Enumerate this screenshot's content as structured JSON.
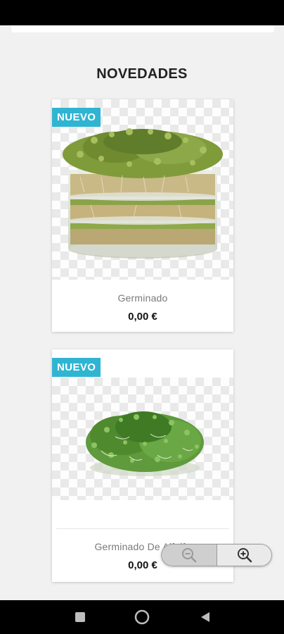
{
  "section": {
    "title": "NOVEDADES"
  },
  "products": [
    {
      "badge": "NUEVO",
      "name": "Germinado",
      "price": "0,00 €",
      "image_icon": "sprouting-jar-image"
    },
    {
      "badge": "NUEVO",
      "name": "Germinado De Alfalfa",
      "price": "0,00 €",
      "image_icon": "alfalfa-sprouts-image"
    }
  ],
  "zoom": {
    "out_icon": "zoom-out-icon",
    "in_icon": "zoom-in-icon"
  },
  "navigation": {
    "recents_icon": "square-recents-icon",
    "home_icon": "circle-home-icon",
    "back_icon": "triangle-back-icon"
  },
  "colors": {
    "badge": "#2fb5d2",
    "background": "#f1f1f1",
    "system_bars": "#000000"
  }
}
